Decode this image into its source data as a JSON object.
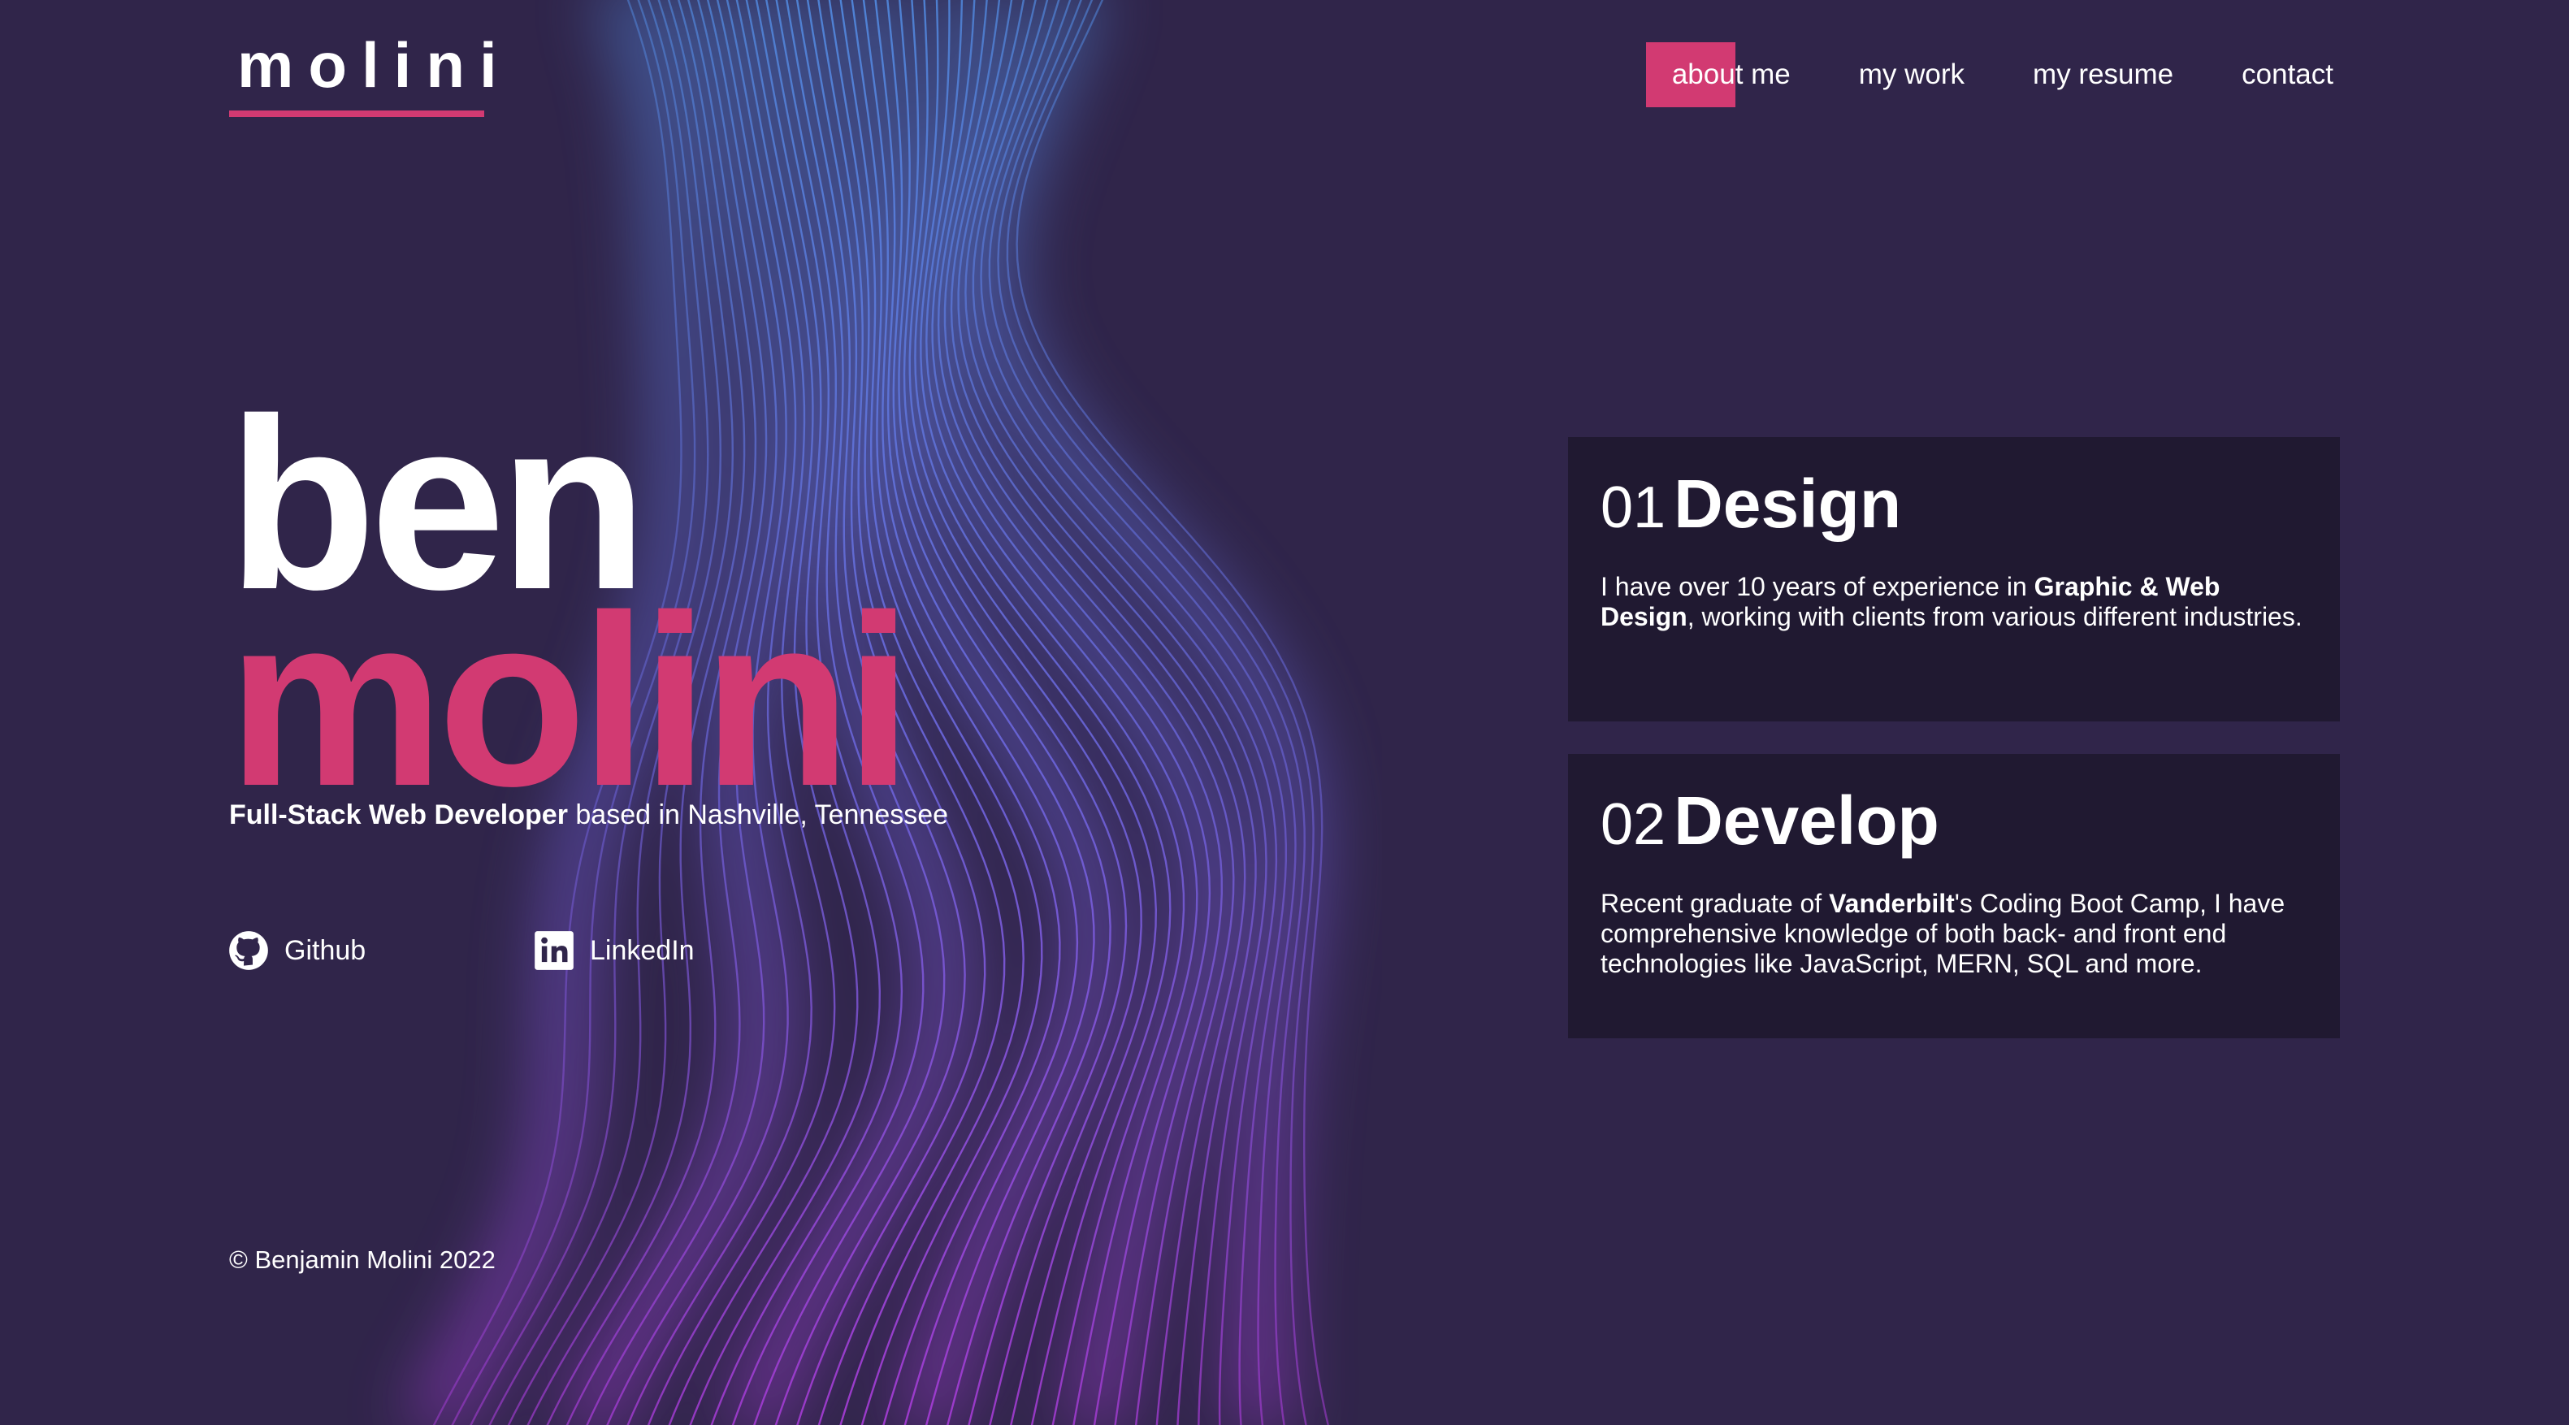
{
  "colors": {
    "background": "#30254a",
    "accent": "#d23a72",
    "card": "#1e182e",
    "wave_blue": "#4f86d9",
    "wave_purple": "#a23ad0"
  },
  "header": {
    "logo": "molini",
    "nav": [
      {
        "label": "about me",
        "active": true
      },
      {
        "label": "my work",
        "active": false
      },
      {
        "label": "my resume",
        "active": false
      },
      {
        "label": "contact",
        "active": false
      }
    ]
  },
  "hero": {
    "first_name": "ben",
    "last_name": "molini",
    "tagline_bold": "Full-Stack Web Developer",
    "tagline_rest": " based in Nashville, Tennessee"
  },
  "social": {
    "github": {
      "label": "Github",
      "icon": "github-icon"
    },
    "linkedin": {
      "label": "LinkedIn",
      "icon": "linkedin-icon"
    }
  },
  "cards": {
    "design": {
      "number": "01",
      "title": "Design",
      "text_1": "I have over 10 years of experience in ",
      "text_bold": "Graphic & Web Design",
      "text_2": ", working with clients from various different industries."
    },
    "develop": {
      "number": "02",
      "title": "Develop",
      "text_1": "Recent graduate of ",
      "text_bold": "Vanderbilt",
      "text_2": "'s Coding Boot Camp, I have comprehensive knowledge of both back- and front end technologies like JavaScript, MERN, SQL and more."
    }
  },
  "footer": {
    "copyright": "© Benjamin Molini 2022"
  }
}
